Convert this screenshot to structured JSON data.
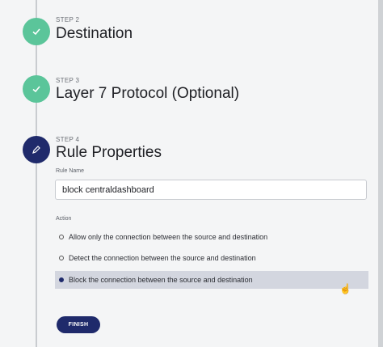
{
  "steps": [
    {
      "caption": "STEP 2",
      "title": "Destination",
      "status": "done",
      "icon": "check-icon"
    },
    {
      "caption": "STEP 3",
      "title": "Layer 7 Protocol (Optional)",
      "status": "done",
      "icon": "check-icon"
    },
    {
      "caption": "STEP 4",
      "title": "Rule Properties",
      "status": "active",
      "icon": "pencil-icon"
    }
  ],
  "form": {
    "rule_name_label": "Rule Name",
    "rule_name_value": "block centraldashboard",
    "action_label": "Action",
    "actions": [
      {
        "label": "Allow only the connection between the source and destination",
        "selected": false
      },
      {
        "label": "Detect the connection between the source and destination",
        "selected": false
      },
      {
        "label": "Block the connection between the source and destination",
        "selected": true
      }
    ],
    "finish_label": "FINISH"
  },
  "colors": {
    "done": "#5bc59a",
    "active": "#1f2a6b"
  }
}
